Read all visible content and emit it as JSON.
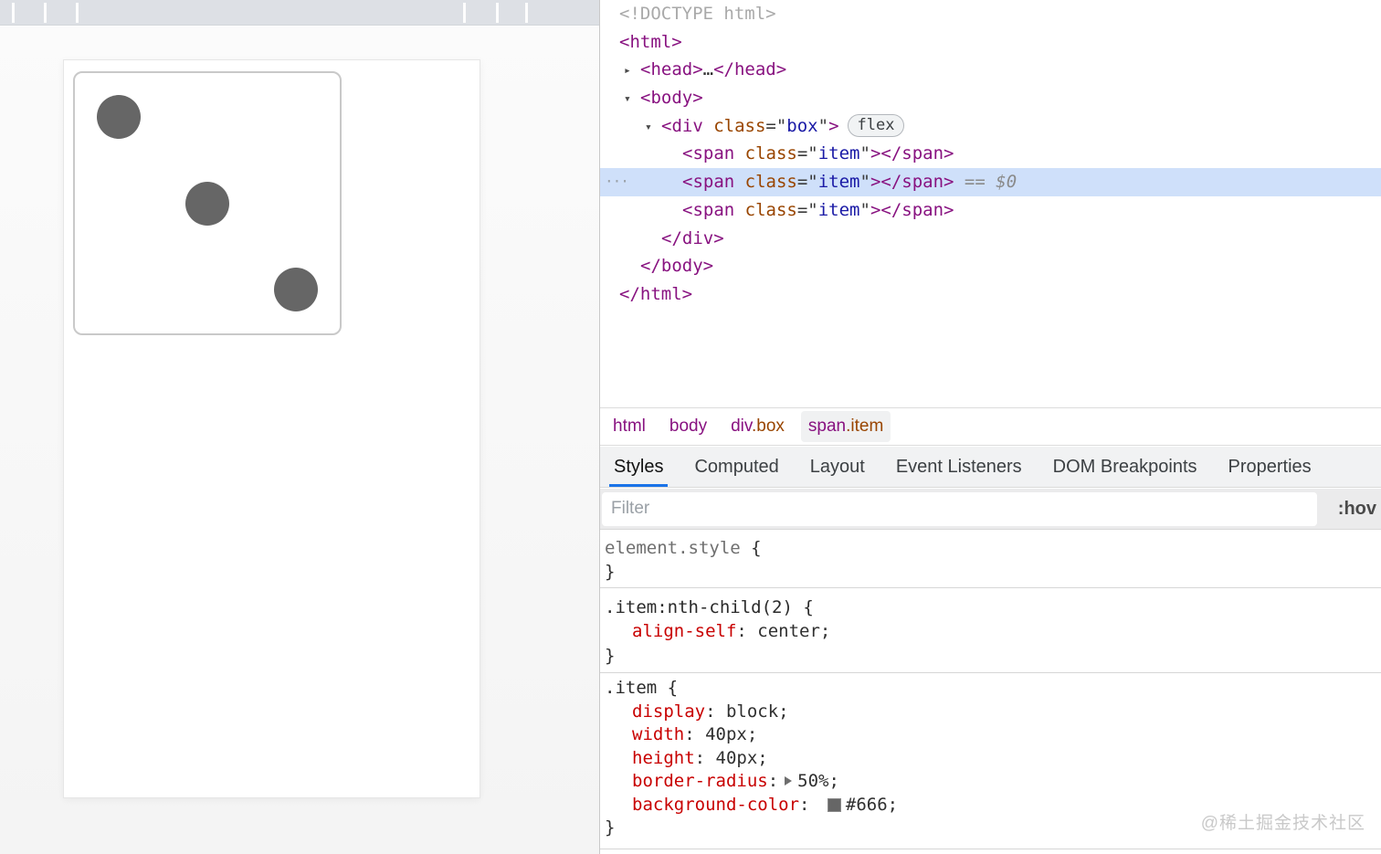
{
  "colors": {
    "accent_blue": "#1a73e8",
    "selection_blue": "#cfe0fa",
    "dot_gray": "#666666"
  },
  "page_preview": {
    "dice_dot_count": 3
  },
  "devtools": {
    "icons": {
      "expand_arrow_expanded": "▾",
      "expand_arrow_collapsed": "▸",
      "overflow_dots": "···"
    },
    "dom_tree": {
      "rows": [
        {
          "indent": 0,
          "tokens": [
            {
              "text": "<!DOCTYPE html>",
              "type": "doctype"
            }
          ]
        },
        {
          "indent": 0,
          "tokens": [
            {
              "text": "<html>",
              "type": "tag"
            }
          ]
        },
        {
          "indent": 1,
          "arrow": "collapsed",
          "tokens": [
            {
              "text": "<head>",
              "type": "tag"
            },
            {
              "text": "…",
              "type": "plain"
            },
            {
              "text": "</head>",
              "type": "tag"
            }
          ]
        },
        {
          "indent": 1,
          "arrow": "expanded",
          "tokens": [
            {
              "text": "<body>",
              "type": "tag"
            }
          ]
        },
        {
          "indent": 2,
          "arrow": "expanded",
          "badge": "flex",
          "tokens": [
            {
              "text": "<div ",
              "type": "tag"
            },
            {
              "text": "class",
              "type": "attr"
            },
            {
              "text": "=\"",
              "type": "punct"
            },
            {
              "text": "box",
              "type": "val"
            },
            {
              "text": "\"",
              "type": "punct"
            },
            {
              "text": ">",
              "type": "tag"
            }
          ]
        },
        {
          "indent": 3,
          "tokens": [
            {
              "text": "<span ",
              "type": "tag"
            },
            {
              "text": "class",
              "type": "attr"
            },
            {
              "text": "=\"",
              "type": "punct"
            },
            {
              "text": "item",
              "type": "val"
            },
            {
              "text": "\"",
              "type": "punct"
            },
            {
              "text": ">",
              "type": "tag"
            },
            {
              "text": "</span>",
              "type": "tag"
            }
          ]
        },
        {
          "indent": 3,
          "selected": true,
          "tokens": [
            {
              "text": "<span ",
              "type": "tag"
            },
            {
              "text": "class",
              "type": "attr"
            },
            {
              "text": "=\"",
              "type": "punct"
            },
            {
              "text": "item",
              "type": "val"
            },
            {
              "text": "\"",
              "type": "punct"
            },
            {
              "text": ">",
              "type": "tag"
            },
            {
              "text": "</span>",
              "type": "tag"
            },
            {
              "text": " == ",
              "type": "eq"
            },
            {
              "text": "$0",
              "type": "dollar"
            }
          ]
        },
        {
          "indent": 3,
          "tokens": [
            {
              "text": "<span ",
              "type": "tag"
            },
            {
              "text": "class",
              "type": "attr"
            },
            {
              "text": "=\"",
              "type": "punct"
            },
            {
              "text": "item",
              "type": "val"
            },
            {
              "text": "\"",
              "type": "punct"
            },
            {
              "text": ">",
              "type": "tag"
            },
            {
              "text": "</span>",
              "type": "tag"
            }
          ]
        },
        {
          "indent": 2,
          "tokens": [
            {
              "text": "</div>",
              "type": "tag"
            }
          ]
        },
        {
          "indent": 1,
          "tokens": [
            {
              "text": "</body>",
              "type": "tag"
            }
          ]
        },
        {
          "indent": 0,
          "tokens": [
            {
              "text": "</html>",
              "type": "tag"
            }
          ]
        }
      ]
    },
    "breadcrumbs": {
      "items": [
        {
          "parts": [
            {
              "text": "html",
              "type": "el"
            }
          ]
        },
        {
          "parts": [
            {
              "text": "body",
              "type": "el"
            }
          ]
        },
        {
          "parts": [
            {
              "text": "div",
              "type": "el"
            },
            {
              "text": ".box",
              "type": "cls"
            }
          ]
        },
        {
          "parts": [
            {
              "text": "span",
              "type": "el"
            },
            {
              "text": ".item",
              "type": "cls"
            }
          ],
          "selected": true
        }
      ]
    },
    "tabs": {
      "items": [
        "Styles",
        "Computed",
        "Layout",
        "Event Listeners",
        "DOM Breakpoints",
        "Properties"
      ],
      "active": "Styles"
    },
    "filter": {
      "placeholder": "Filter",
      "hover_toggle": ":hov"
    },
    "styles_pane": {
      "sections": [
        {
          "rows": [
            {
              "tokens": [
                {
                  "text": "element.style",
                  "type": "selgray"
                },
                {
                  "text": " {",
                  "type": "dark"
                }
              ]
            },
            {
              "tokens": [
                {
                  "text": "}",
                  "type": "dark"
                }
              ]
            }
          ]
        },
        {
          "rows": [
            {
              "tokens": [
                {
                  "text": ".item:nth-child(2) {",
                  "type": "sel"
                }
              ]
            },
            {
              "indent": true,
              "tokens": [
                {
                  "text": "align-self",
                  "type": "prop"
                },
                {
                  "text": ": ",
                  "type": "dark"
                },
                {
                  "text": "center;",
                  "type": "dark"
                }
              ]
            },
            {
              "tokens": [
                {
                  "text": "}",
                  "type": "dark"
                }
              ]
            }
          ]
        },
        {
          "rows": [
            {
              "tokens": [
                {
                  "text": ".item {",
                  "type": "sel"
                }
              ]
            },
            {
              "indent": true,
              "tokens": [
                {
                  "text": "display",
                  "type": "prop"
                },
                {
                  "text": ": ",
                  "type": "dark"
                },
                {
                  "text": "block;",
                  "type": "dark"
                }
              ]
            },
            {
              "indent": true,
              "tokens": [
                {
                  "text": "width",
                  "type": "prop"
                },
                {
                  "text": ": ",
                  "type": "dark"
                },
                {
                  "text": "40px;",
                  "type": "dark"
                }
              ]
            },
            {
              "indent": true,
              "tokens": [
                {
                  "text": "height",
                  "type": "prop"
                },
                {
                  "text": ": ",
                  "type": "dark"
                },
                {
                  "text": "40px;",
                  "type": "dark"
                }
              ]
            },
            {
              "indent": true,
              "tokens": [
                {
                  "text": "border-radius",
                  "type": "prop"
                },
                {
                  "text": ":",
                  "type": "dark"
                },
                {
                  "type": "tri"
                },
                {
                  "text": "50%;",
                  "type": "dark"
                }
              ]
            },
            {
              "indent": true,
              "tokens": [
                {
                  "text": "background-color",
                  "type": "prop"
                },
                {
                  "text": ": ",
                  "type": "dark"
                },
                {
                  "type": "swatch",
                  "color": "#666666"
                },
                {
                  "text": "#666;",
                  "type": "dark"
                }
              ]
            },
            {
              "tokens": [
                {
                  "text": "}",
                  "type": "dark"
                }
              ]
            }
          ]
        }
      ]
    },
    "watermark": "@稀土掘金技术社区"
  }
}
